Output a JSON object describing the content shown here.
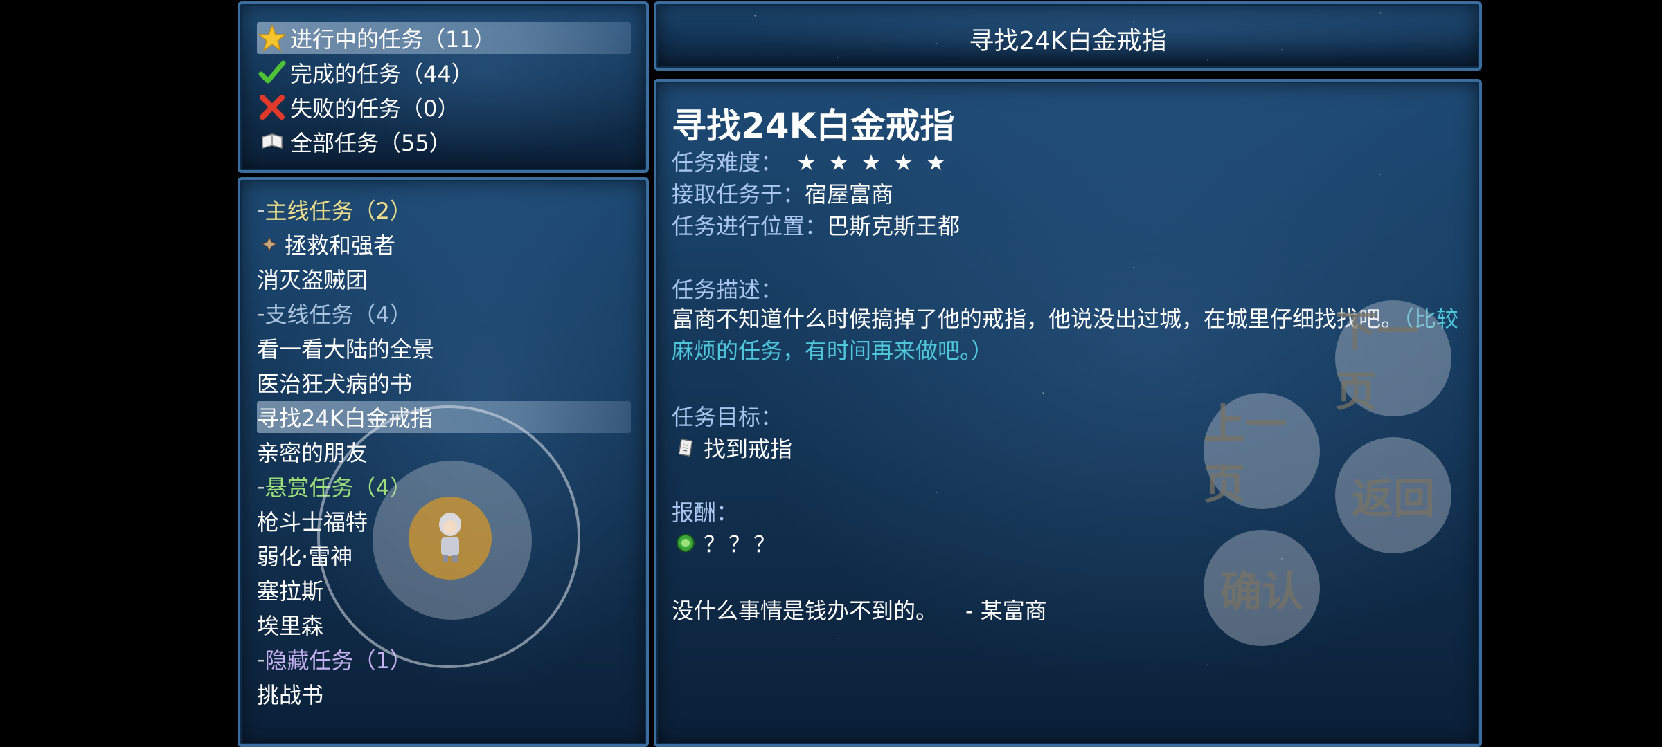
{
  "status_menu": [
    {
      "icon": "star-icon",
      "label": "进行中的任务（11）",
      "selected": true
    },
    {
      "icon": "checkmark-icon",
      "label": "完成的任务（44）",
      "selected": false
    },
    {
      "icon": "cross-icon",
      "label": "失败的任务（0）",
      "selected": false
    },
    {
      "icon": "book-icon",
      "label": "全部任务（55）",
      "selected": false
    }
  ],
  "quest_list": {
    "main_category": "主线任务（2）",
    "main_items": [
      "拯救和强者",
      "消灭盗贼团"
    ],
    "side_category": "支线任务（4）",
    "side_items": [
      "看一看大陆的全景",
      "医治狂犬病的书",
      "寻找24K白金戒指",
      "亲密的朋友"
    ],
    "bounty_category": "悬赏任务（4）",
    "bounty_items": [
      "枪斗士福特",
      "弱化·雷神",
      "塞拉斯",
      "埃里森"
    ],
    "hidden_category": "隐藏任务（1）",
    "hidden_items": [
      "挑战书"
    ],
    "dash": "-"
  },
  "header": {
    "title": "寻找24K白金戒指"
  },
  "detail": {
    "title": "寻找24K白金戒指",
    "difficulty_label": "任务难度：",
    "difficulty_stars": 5,
    "accepted_label": "接取任务于：",
    "accepted_value": "宿屋富商",
    "location_label": "任务进行位置：",
    "location_value": "巴斯克斯王都",
    "description_label": "任务描述：",
    "description_text": "富商不知道什么时候搞掉了他的戒指，他说没出过城，在城里仔细找找吧。",
    "description_note": "（比较麻烦的任务，有时间再来做吧。）",
    "objective_label": "任务目标：",
    "objective_item": "找到戒指",
    "reward_label": "报酬：",
    "reward_value": "？？？",
    "quote": "没什么事情是钱办不到的。",
    "quote_author": "-  某富商"
  },
  "controls": {
    "next_page": "下一页",
    "prev_page": "上一页",
    "back": "返回",
    "confirm": "确认"
  },
  "colors": {
    "main_category": "#f0de8a",
    "side_category": "#a9c3e0",
    "bounty_category": "#9fe07a",
    "hidden_category": "#c6b2f0",
    "description_note": "#4fc7d9",
    "panel_border": "#3b6e9c"
  }
}
